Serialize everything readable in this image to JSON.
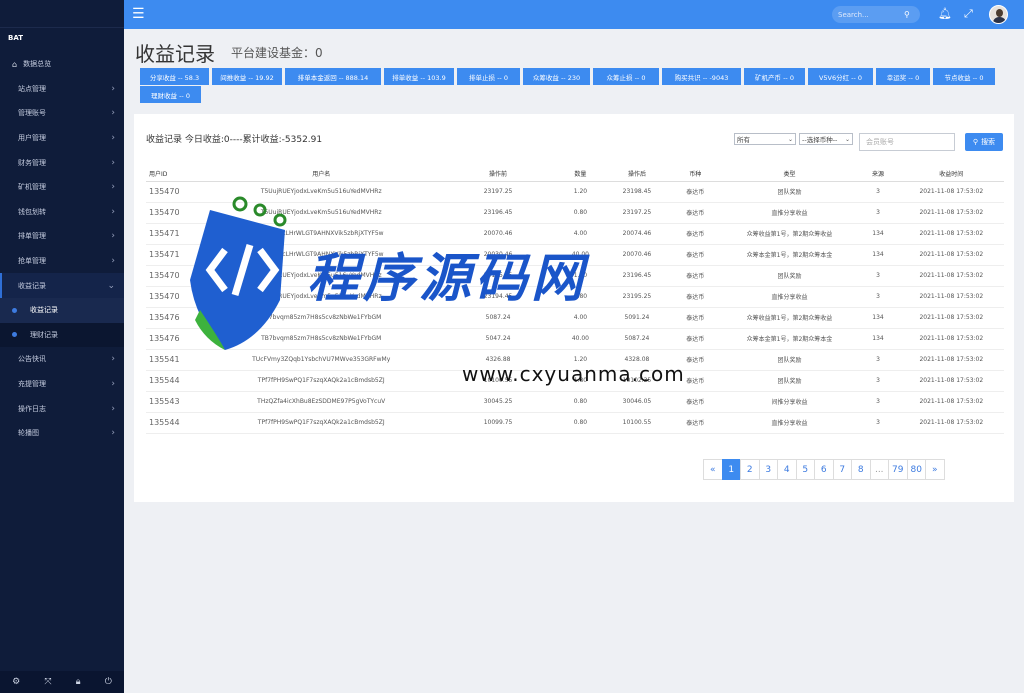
{
  "sidebar": {
    "brand": "BAT",
    "home_label": "数据总览",
    "items": [
      "站点管理",
      "管理账号",
      "用户管理",
      "财务管理",
      "矿机管理",
      "钱包划转",
      "排单管理",
      "抢单管理"
    ],
    "open_item": "收益记录",
    "sub_items": [
      "收益记录",
      "理财记录"
    ],
    "items_after": [
      "公告快讯",
      "充提管理",
      "操作日志",
      "轮播图"
    ]
  },
  "topbar": {
    "search_placeholder": "Search..."
  },
  "header": {
    "title": "收益记录",
    "subtitle": "平台建设基金：0"
  },
  "summary_buttons": [
    "分享收益 -- 58.3",
    "间推收益 -- 19.92",
    "排单本金返回 -- 888.14",
    "排单收益 -- 103.9",
    "排单止损 -- 0",
    "众筹收益 -- 230",
    "众筹止损 -- 0",
    "购买共识 -- -9043",
    "矿机产币 -- 0",
    "V5V6分红 -- 0",
    "幸运奖 -- 0",
    "节点收益 -- 0",
    "理财收益 -- 0"
  ],
  "panel": {
    "title": "收益记录 今日收益:0----累计收益:-5352.91",
    "filter_all": "所有",
    "filter_coin": "--选择币种--",
    "member_placeholder": "会员账号",
    "search_btn": "搜索"
  },
  "table": {
    "headers": [
      "用户ID",
      "用户名",
      "操作前",
      "数量",
      "操作后",
      "币种",
      "类型",
      "来源",
      "收益时间"
    ],
    "rows": [
      [
        "135470",
        "T5UujRUEYjodxLveKm5u516uYedMVHRz",
        "23197.25",
        "1.20",
        "23198.45",
        "泰达币",
        "团队奖励",
        "3",
        "2021-11-08 17:53:02"
      ],
      [
        "135470",
        "T5UujRUEYjodxLveKm5u516uYedMVHRz",
        "23196.45",
        "0.80",
        "23197.25",
        "泰达币",
        "直推分享收益",
        "3",
        "2021-11-08 17:53:02"
      ],
      [
        "135471",
        "TKBoeUcLHrWLGT9AHNXVik5zbRjXTYF5w",
        "20070.46",
        "4.00",
        "20074.46",
        "泰达币",
        "众筹收益第1号，第2期众筹收益",
        "134",
        "2021-11-08 17:53:02"
      ],
      [
        "135471",
        "TKBoeUcLHrWLGT9AHNXVik5zbRjXTYF5w",
        "20030.46",
        "40.00",
        "20070.46",
        "泰达币",
        "众筹本金第1号，第2期众筹本金",
        "134",
        "2021-11-08 17:53:02"
      ],
      [
        "135470",
        "T5UujRUEYjodxLveKm5u516uYedMVHRz",
        "23195.25",
        "1.20",
        "23196.45",
        "泰达币",
        "团队奖励",
        "3",
        "2021-11-08 17:53:02"
      ],
      [
        "135470",
        "T5UujRUEYjodxLveKm5u516uYedMVHRz",
        "23194.45",
        "0.80",
        "23195.25",
        "泰达币",
        "直推分享收益",
        "3",
        "2021-11-08 17:53:02"
      ],
      [
        "135476",
        "TB7bvqm85zm7H8s5cv8zNbWe1FYbGM",
        "5087.24",
        "4.00",
        "5091.24",
        "泰达币",
        "众筹收益第1号，第2期众筹收益",
        "134",
        "2021-11-08 17:53:02"
      ],
      [
        "135476",
        "TB7bvqm85zm7H8s5cv8zNbWe1FYbGM",
        "5047.24",
        "40.00",
        "5087.24",
        "泰达币",
        "众筹本金第1号，第2期众筹本金",
        "134",
        "2021-11-08 17:53:02"
      ],
      [
        "135541",
        "TUcFVmy3ZQqb1YsbchVU7MWve353GRFwMy",
        "4326.88",
        "1.20",
        "4328.08",
        "泰达币",
        "团队奖励",
        "3",
        "2021-11-08 17:53:02"
      ],
      [
        "135544",
        "TPf7fPH9SwPQ1F7szqXAQk2a1cBmdsb5ZJ",
        "10100.55",
        "1.80",
        "10102.35",
        "泰达币",
        "团队奖励",
        "3",
        "2021-11-08 17:53:02"
      ],
      [
        "135543",
        "THzQZfa4icXhBu8EzSDDME97P5gVoTYcuV",
        "30045.25",
        "0.80",
        "30046.05",
        "泰达币",
        "间推分享收益",
        "3",
        "2021-11-08 17:53:02"
      ],
      [
        "135544",
        "TPf7fPH9SwPQ1F7szqXAQk2a1cBmdsb5ZJ",
        "10099.75",
        "0.80",
        "10100.55",
        "泰达币",
        "直推分享收益",
        "3",
        "2021-11-08 17:53:02"
      ]
    ]
  },
  "pagination": [
    "«",
    "1",
    "2",
    "3",
    "4",
    "5",
    "6",
    "7",
    "8",
    "...",
    "79",
    "80",
    "»"
  ],
  "watermark": {
    "text": "程序源码网",
    "url": "www.cxyuanma.com"
  }
}
